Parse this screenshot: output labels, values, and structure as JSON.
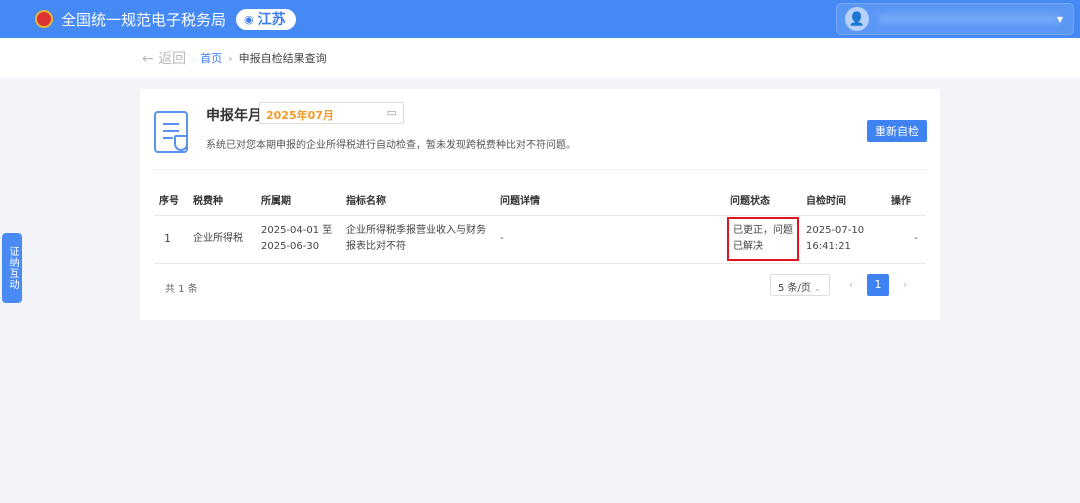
{
  "header": {
    "title": "全国统一规范电子税务局",
    "province": "江苏"
  },
  "subnav": {
    "back": "返回",
    "breadcrumb": [
      "首页",
      "申报自检结果查询"
    ],
    "sep": "›"
  },
  "card": {
    "label": "申报年月",
    "month": "2025年07月",
    "description": "系统已对您本期申报的企业所得税进行自动检查，暂未发现跨税费种比对不符问题。",
    "recheck": "重新自检"
  },
  "table": {
    "headers": [
      "序号",
      "税费种",
      "所属期",
      "指标名称",
      "问题详情",
      "问题状态",
      "自检时间",
      "操作"
    ],
    "rows": [
      {
        "no": "1",
        "tax": "企业所得税",
        "period_start": "2025-04-01 至",
        "period_end": "2025-06-30",
        "indicator": "企业所得税季报营业收入与财务报表比对不符",
        "detail": "-",
        "status": "已更正，问题已解决",
        "time_date": "2025-07-10",
        "time_clock": "16:41:21",
        "action": "-"
      }
    ]
  },
  "pagination": {
    "total": "共 1 条",
    "page_size": "5 条/页",
    "current": "1",
    "prev": "‹",
    "next": "›"
  },
  "side_tab": "证纳互动",
  "colors": {
    "primary": "#4489f4",
    "accent": "#f39a2b",
    "highlight": "#e0141e"
  }
}
